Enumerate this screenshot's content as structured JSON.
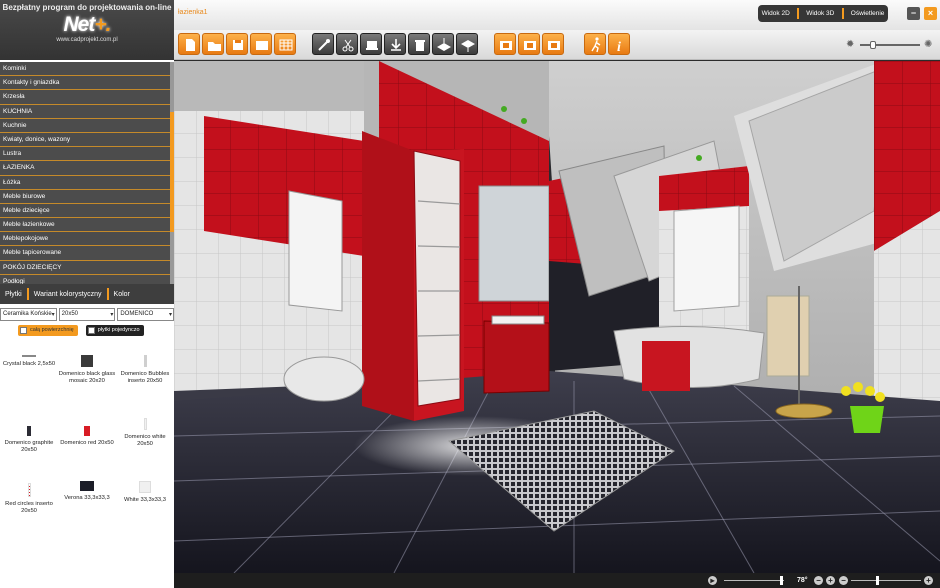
{
  "app": {
    "tagline": "Bezpłatny program do projektowania on-line",
    "brand": "Net",
    "brand_plus": "+.",
    "url": "www.cadprojekt.com.pl",
    "project_title": "łazienka1",
    "accent": "#f39a1f"
  },
  "view_switch": {
    "view2d": "Widok 2D",
    "view3d": "Widok 3D",
    "lighting": "Oświetlenie"
  },
  "window": {
    "minimize_icon": "minimize-icon",
    "close_icon": "close-icon"
  },
  "categories": [
    "Kominki",
    "Kontakty i gniazdka",
    "Krzesła",
    "KUCHNIA",
    "Kuchnie",
    "Kwiaty, donice, wazony",
    "Lustra",
    "ŁAZIENKA",
    "Łóżka",
    "Meble biurowe",
    "Meble dziecięce",
    "Meble łazienkowe",
    "Meblepokojowe",
    "Meble tapicerowane",
    "POKÓJ DZIECIĘCY",
    "Podłogi"
  ],
  "tabs": {
    "tiles": "Płytki",
    "color_variant": "Wariant kolorystyczny",
    "color": "Kolor"
  },
  "filters": {
    "manufacturer": "Ceramika Końskie",
    "size": "20x50",
    "series": "DOMENICO"
  },
  "modes": {
    "whole_surface": "całą powierzchnię",
    "single_tiles": "płytki pojedynczo"
  },
  "tiles": [
    {
      "name": "Crystal black 2,5x50",
      "swatch": "#888888"
    },
    {
      "name": "Domenico black glass mosaic 20x20",
      "swatch": "#3a3a3a"
    },
    {
      "name": "Domenico Bubbles inserto 20x50",
      "swatch": "#cfcfcf"
    },
    {
      "name": "Domenico graphite 20x50",
      "swatch": "#2c2c35"
    },
    {
      "name": "Domenico red 20x50",
      "swatch": "#d81c25"
    },
    {
      "name": "Domenico white 20x50",
      "swatch": "#f1f1f1"
    },
    {
      "name": "Red circles inserto 20x50",
      "swatch": "#ffffff"
    },
    {
      "name": "Verona 33,3x33,3",
      "swatch": "#1b1d28"
    },
    {
      "name": "White 33,3x33,3",
      "swatch": "#f0f0f0"
    }
  ],
  "toolbar_icons": [
    "new-file-icon",
    "open-folder-icon",
    "save-icon",
    "save-as-icon",
    "export-icon",
    "measure-icon",
    "scissors-icon",
    "print-icon",
    "download-icon",
    "trash-icon",
    "layer-up-icon",
    "layer-down-icon",
    "film-icon",
    "film-icon",
    "film-icon",
    "walk-icon",
    "info-icon"
  ],
  "zoom": {
    "value": "78°",
    "minus": "−",
    "plus": "+"
  }
}
